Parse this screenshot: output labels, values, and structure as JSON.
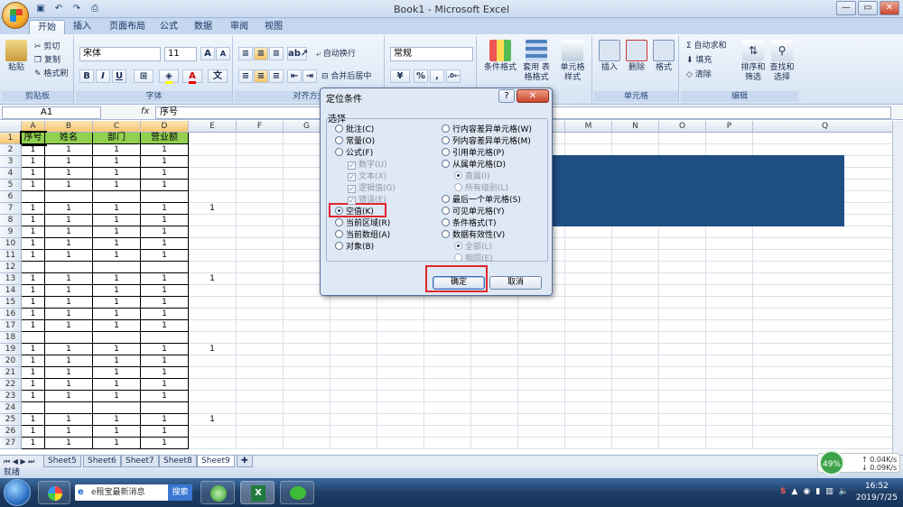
{
  "window": {
    "title": "Book1 - Microsoft Excel",
    "controls": [
      "—",
      "▭",
      "✕"
    ]
  },
  "ribbon_tabs": [
    "开始",
    "插入",
    "页面布局",
    "公式",
    "数据",
    "审阅",
    "视图"
  ],
  "ribbon": {
    "clipboard": {
      "label": "剪贴板",
      "paste": "粘贴",
      "cut": "剪切",
      "copy": "复制",
      "format_painter": "格式刷"
    },
    "font": {
      "label": "字体",
      "name": "宋体",
      "size": "11",
      "grow": "A",
      "shrink": "A",
      "bold": "B",
      "italic": "I",
      "underline": "U"
    },
    "alignment": {
      "label": "对齐方式",
      "wrap": "自动换行",
      "merge": "合并后居中"
    },
    "number": {
      "format": "常规",
      "percent": "%",
      "comma": ","
    },
    "styles": {
      "cond_format": "条件格式",
      "table_format": "套用 表格格式",
      "cell_styles": "单元格 样式"
    },
    "cells": {
      "label": "单元格",
      "insert": "插入",
      "delete": "删除",
      "format": "格式"
    },
    "editing": {
      "label": "编辑",
      "autosum": "Σ 自动求和",
      "fill": "填充",
      "clear": "清除",
      "sort": "排序和 筛选",
      "find": "查找和 选择"
    }
  },
  "formula_bar": {
    "name_box": "A1",
    "fx": "fx",
    "value": "序号"
  },
  "columns": [
    "A",
    "B",
    "C",
    "D",
    "E",
    "F",
    "G",
    "H",
    "I",
    "J",
    "K",
    "L",
    "M",
    "N",
    "O",
    "P",
    "Q"
  ],
  "rows": [
    "1",
    "2",
    "3",
    "4",
    "5",
    "6",
    "7",
    "8",
    "9",
    "10",
    "11",
    "12",
    "13",
    "14",
    "15",
    "16",
    "17",
    "18",
    "19",
    "20",
    "21",
    "22",
    "23",
    "24",
    "25",
    "26",
    "27"
  ],
  "headers": [
    "序号",
    "姓名",
    "部门",
    "营业额"
  ],
  "cell_value": "1",
  "empty_rows": [
    "6",
    "12",
    "18",
    "24"
  ],
  "e_column_rows": [
    "7",
    "13",
    "19",
    "25"
  ],
  "sheets": [
    "Sheet5",
    "Sheet6",
    "Sheet7",
    "Sheet8",
    "Sheet9"
  ],
  "active_sheet": "Sheet9",
  "status": "就绪",
  "dialog": {
    "title": "定位条件",
    "help": "?",
    "close": "✕",
    "section": "选择",
    "left_options": [
      "批注(C)",
      "常量(O)",
      "公式(F)",
      "数字(U)",
      "文本(X)",
      "逻辑值(G)",
      "错误(E)",
      "空值(K)",
      "当前区域(R)",
      "当前数组(A)",
      "对象(B)"
    ],
    "right_options": [
      "行内容差异单元格(W)",
      "列内容差异单元格(M)",
      "引用单元格(P)",
      "从属单元格(D)",
      "直属(I)",
      "所有级别(L)",
      "最后一个单元格(S)",
      "可见单元格(Y)",
      "条件格式(T)",
      "数据有效性(V)",
      "全部(L)",
      "相同(E)"
    ],
    "selected": "空值(K)",
    "ok": "确定",
    "cancel": "取消"
  },
  "taskbar": {
    "search_placeholder": "e租宝最新消息",
    "search_button": "搜索",
    "time": "16:52",
    "date": "2019/7/25"
  },
  "network": {
    "percent": "49%",
    "up": "0.04K/s",
    "down": "0.09K/s"
  },
  "colors": {
    "header_fill": "#92d050",
    "blue_block": "#1f4e84",
    "highlight_red": "#e0262a"
  }
}
